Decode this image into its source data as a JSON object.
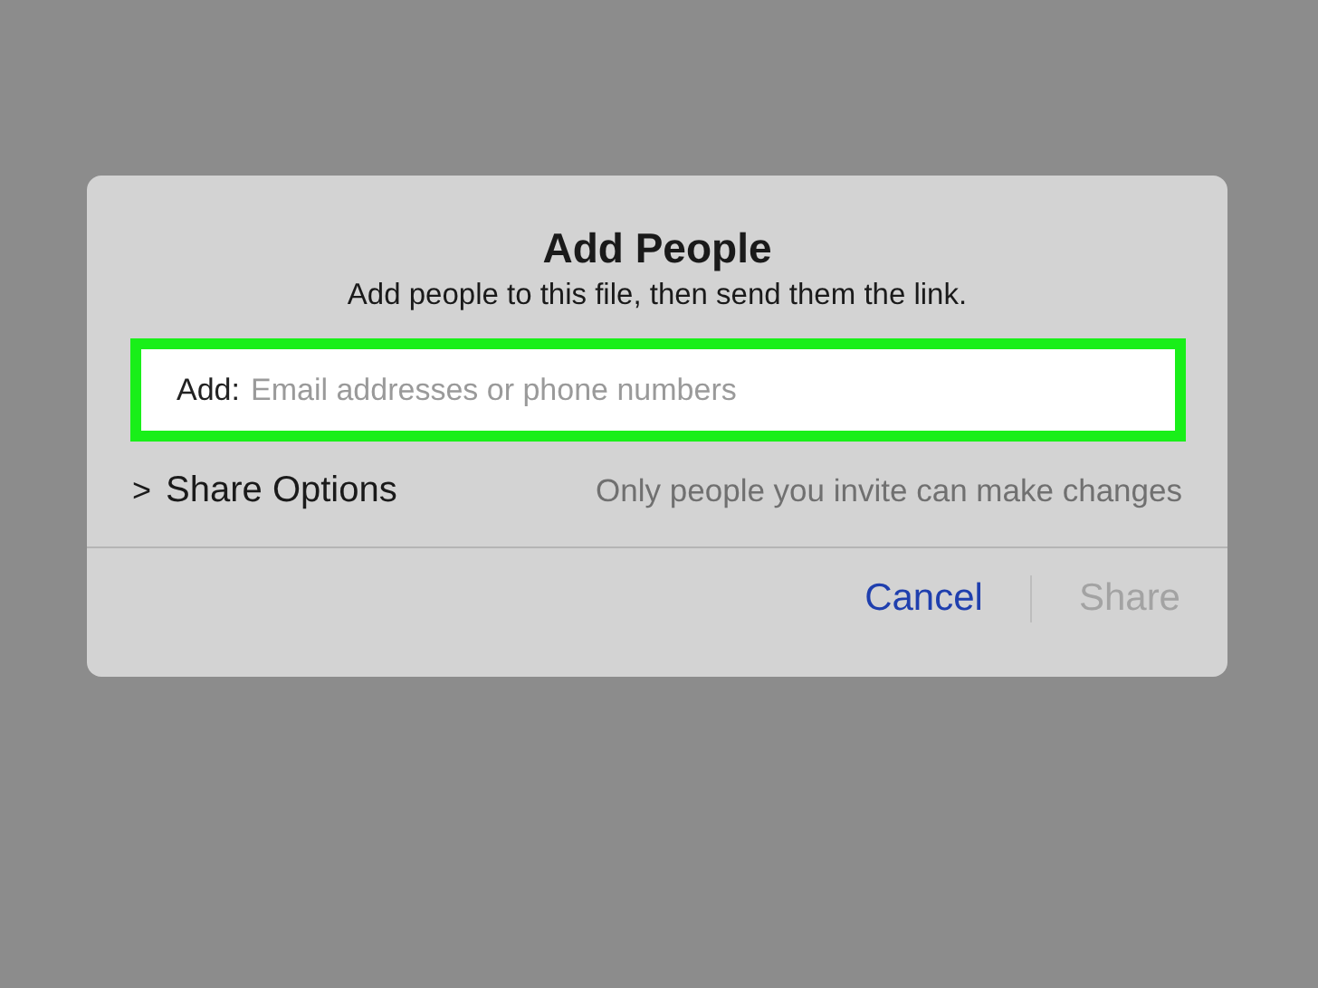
{
  "dialog": {
    "title": "Add People",
    "subtitle": "Add people to this file, then send them the link.",
    "field": {
      "label": "Add:",
      "placeholder": "Email addresses or phone numbers",
      "highlighted": true
    },
    "share_options": {
      "chevron": ">",
      "label": "Share Options",
      "expanded": false,
      "note": "Only people you invite can make changes"
    },
    "buttons": [
      {
        "label": "Cancel",
        "disabled": false
      },
      {
        "label": "Share",
        "disabled": true
      }
    ]
  }
}
